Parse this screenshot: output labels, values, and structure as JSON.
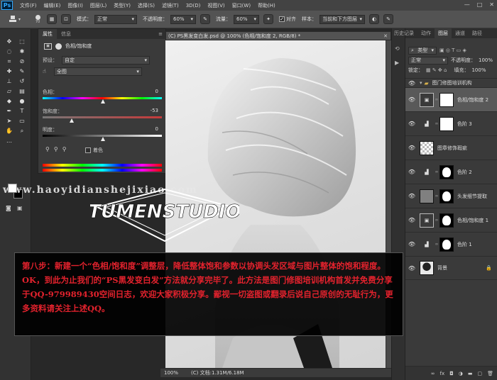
{
  "app": {
    "logo": "Ps"
  },
  "menu": [
    "文件(F)",
    "编辑(E)",
    "图像(I)",
    "图层(L)",
    "类型(Y)",
    "选择(S)",
    "滤镜(T)",
    "3D(D)",
    "视图(V)",
    "窗口(W)",
    "帮助(H)"
  ],
  "window_controls": {
    "minimize": "—",
    "maximize": "□",
    "close": "✕"
  },
  "options": {
    "brush_size": "70",
    "mode_label": "模式：",
    "mode_value": "正常",
    "opacity_label": "不透明度：",
    "opacity_value": "60%",
    "flow_label": "流量：",
    "flow_value": "60%",
    "align_label": "对齐",
    "sample_label": "样本：",
    "sample_value": "当前和下方图层"
  },
  "properties": {
    "tabs": [
      "属性",
      "信息"
    ],
    "title": "色相/饱和度",
    "preset_label": "预设：",
    "preset_value": "自定",
    "channel_value": "全图",
    "hue_label": "色相：",
    "hue_value": "0",
    "saturation_label": "饱和度：",
    "saturation_value": "-53",
    "lightness_label": "明度：",
    "lightness_value": "0",
    "colorize_label": "着色"
  },
  "document": {
    "tab_title": "(C) PS黑发变白发.psd @ 100% (色相/饱和度 2, RGB/8) *",
    "zoom": "100%",
    "doc_info": "(C) 文档:1.31M/6.18M"
  },
  "right_panel": {
    "history_tabs": [
      "历史记录",
      "动作"
    ],
    "layers_tabs": [
      "图层",
      "通道",
      "路径"
    ],
    "filter_label": "类型",
    "blend_mode": "正常",
    "opacity_label": "不透明度：",
    "opacity_value": "100%",
    "lock_label": "锁定：",
    "fill_label": "填充：",
    "fill_value": "100%",
    "group_name": "图门修图培训机构",
    "layers": [
      {
        "name": "色相/饱和度 2"
      },
      {
        "name": "色阶 3"
      },
      {
        "name": "图章修饰瑕疵"
      },
      {
        "name": "色阶 2"
      },
      {
        "name": "头发细节提取"
      },
      {
        "name": "色相/饱和度 1"
      },
      {
        "name": "色阶 1"
      },
      {
        "name": "背景"
      }
    ],
    "footer_icons": [
      "link-icon",
      "fx-icon",
      "mask-icon",
      "adjustment-icon",
      "folder-icon",
      "new-layer-icon",
      "trash-icon"
    ]
  },
  "watermark": {
    "url": "www.haoyidianshejixiao.com",
    "stamp_text": "TUMENSTUDIO"
  },
  "tutorial": {
    "text": "第八步：新建一个“色相/饱和度”调整层，降低整体饱和参数以协调头发区域与图片整体的饱和程度。OK，到此为止我们的“PS黑发变白发”方法就分享完毕了。此方法是图门修图培训机构首发并免费分享于QQ-979989430空间日志，欢迎大家积极分享。鄙视一切盗图或翻录后说自己原创的无耻行为，更多资料请关注上述QQ。"
  },
  "colors": {
    "accent_blue": "#31a8ff",
    "tutorial_red": "#e3222d",
    "panel_bg": "#3a3a3a"
  }
}
